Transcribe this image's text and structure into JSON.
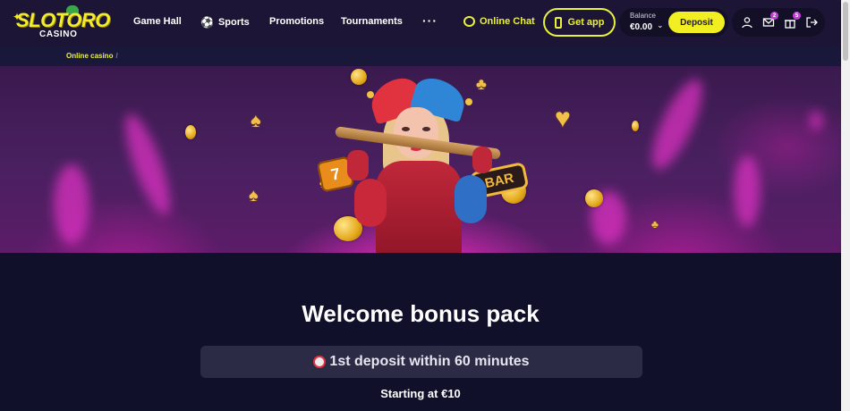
{
  "brand": {
    "logo_main": "SLOTORO",
    "logo_sub": "CASINO"
  },
  "nav": {
    "items": [
      {
        "label": "Game Hall"
      },
      {
        "label": "Sports"
      },
      {
        "label": "Promotions"
      },
      {
        "label": "Tournaments"
      }
    ],
    "more_label": "···",
    "online_chat_label": "Online Chat",
    "get_app_label": "Get app"
  },
  "account": {
    "balance_label": "Balance",
    "balance_value": "€0.00",
    "deposit_label": "Deposit",
    "messages_count": "2",
    "gifts_count": "5"
  },
  "breadcrumb": {
    "items": [
      "Online casino"
    ],
    "separator": "/"
  },
  "banner": {
    "bar_sign_text": "BAR",
    "dice_face": "7"
  },
  "content": {
    "title": "Welcome bonus pack",
    "promo_text": "1st deposit within 60 minutes",
    "starting_text": "Starting at €10"
  },
  "colors": {
    "accent_yellow": "#f1ee22",
    "header_bg": "#1d1535",
    "page_bg": "#11102a",
    "badge_purple": "#c23ed6"
  }
}
